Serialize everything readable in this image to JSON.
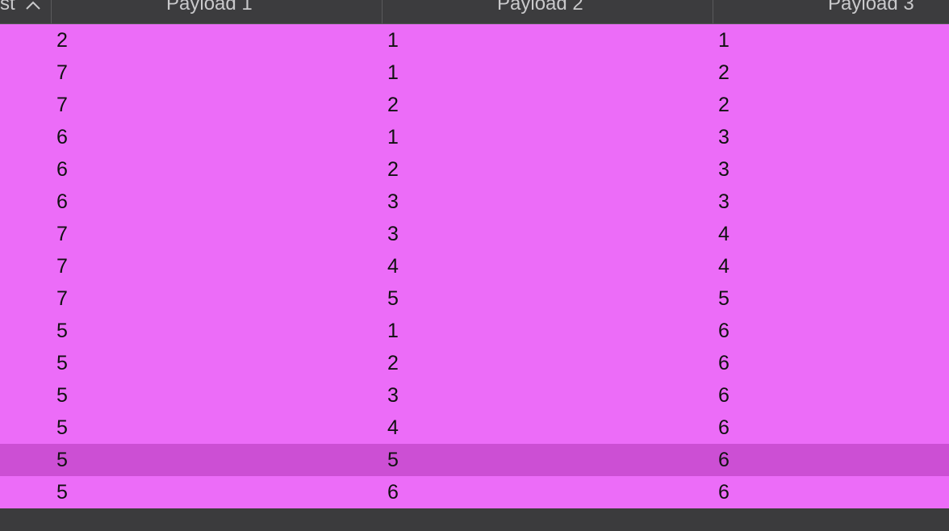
{
  "header": {
    "col0_label": "st",
    "col1_label": "Payload 1",
    "col2_label": "Payload 2",
    "col3_label": "Payload 3",
    "sort_direction": "ascending"
  },
  "colors": {
    "row_background": "#ec6cf8",
    "selected_row_background": "#cc4fd4",
    "header_background": "#3c3c3e"
  },
  "selected_row_index": 13,
  "rows": [
    {
      "p1": "2",
      "p2": "1",
      "p3": "1"
    },
    {
      "p1": "7",
      "p2": "1",
      "p3": "2"
    },
    {
      "p1": "7",
      "p2": "2",
      "p3": "2"
    },
    {
      "p1": "6",
      "p2": "1",
      "p3": "3"
    },
    {
      "p1": "6",
      "p2": "2",
      "p3": "3"
    },
    {
      "p1": "6",
      "p2": "3",
      "p3": "3"
    },
    {
      "p1": "7",
      "p2": "3",
      "p3": "4"
    },
    {
      "p1": "7",
      "p2": "4",
      "p3": "4"
    },
    {
      "p1": "7",
      "p2": "5",
      "p3": "5"
    },
    {
      "p1": "5",
      "p2": "1",
      "p3": "6"
    },
    {
      "p1": "5",
      "p2": "2",
      "p3": "6"
    },
    {
      "p1": "5",
      "p2": "3",
      "p3": "6"
    },
    {
      "p1": "5",
      "p2": "4",
      "p3": "6"
    },
    {
      "p1": "5",
      "p2": "5",
      "p3": "6"
    },
    {
      "p1": "5",
      "p2": "6",
      "p3": "6"
    }
  ]
}
